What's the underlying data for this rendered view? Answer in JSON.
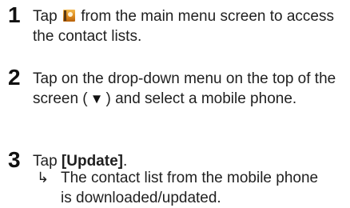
{
  "steps": [
    {
      "number": "1",
      "text_before": "Tap ",
      "icon": "contacts-book-icon",
      "text_after": " from the main menu screen to access the contact lists."
    },
    {
      "number": "2",
      "text_before": "Tap on the drop-down menu on the top of the screen (",
      "symbol": "▼",
      "text_after": ") and select a mobile phone."
    },
    {
      "number": "3",
      "text_before": "Tap ",
      "bold": "[Update]",
      "text_after": "."
    }
  ],
  "result": {
    "arrow": "↳",
    "text": "The contact list from the mobile phone is downloaded/updated."
  }
}
